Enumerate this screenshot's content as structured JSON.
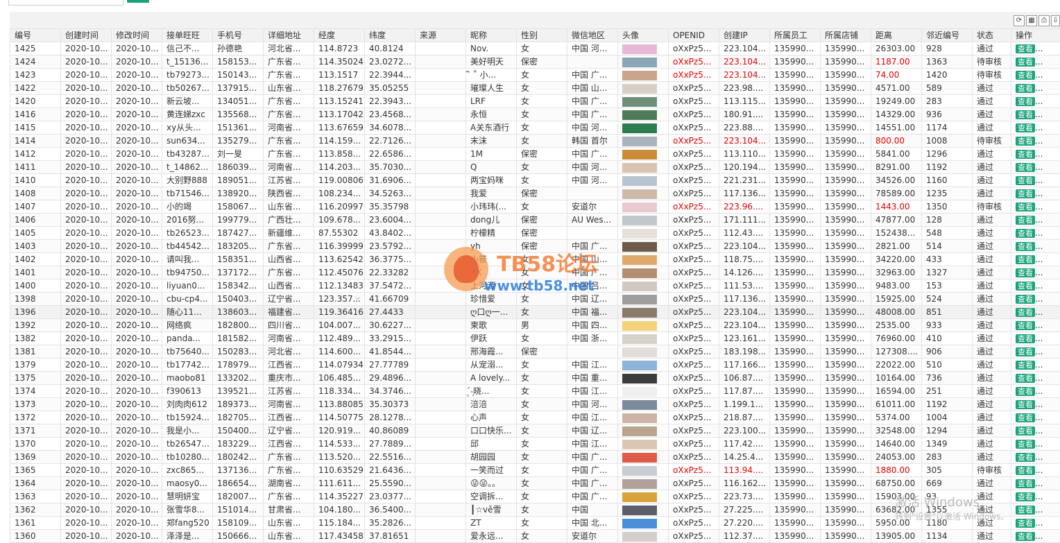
{
  "toolbar": {
    "search_placeholder": "",
    "search_button": "",
    "icons": [
      "refresh-icon",
      "columns-icon",
      "print-icon",
      "export-icon"
    ]
  },
  "columns": [
    "编号",
    "创建时间",
    "修改时间",
    "接单旺旺",
    "手机号",
    "详细地址",
    "经度",
    "纬度",
    "来源",
    "昵称",
    "性别",
    "微信地区",
    "头像",
    "OPENID",
    "创建IP",
    "所属员工",
    "所属店铺",
    "距离",
    "邻近编号",
    "状态",
    "操作"
  ],
  "view_label": "查看",
  "view_suffix": "...",
  "colors": {
    "accent": "#1aa37a",
    "alert": "#e60000"
  },
  "watermark": {
    "title": "TB58论坛",
    "url": "www.tb58.net"
  },
  "windows_watermark": {
    "line1": "激活 Windows",
    "line2": "转到\"设置\"以激活 Windows。"
  },
  "rows": [
    {
      "id": "1425",
      "c": "2020-10...",
      "m": "2020-10...",
      "ww": "信己不...",
      "ph": "孙德艳",
      "addr": "河北省...",
      "lng": "114.8723",
      "lat": "40.8124",
      "src": "",
      "nick": "Nov.",
      "sex": "女",
      "reg": "中国 河...",
      "av": "#e9b8d6",
      "oid": "oXxPz5...",
      "ip": "223.104...",
      "emp": "135990...",
      "shop": "135990...",
      "dist": "26303.00",
      "near": "928",
      "st": "通过",
      "red": false
    },
    {
      "id": "1424",
      "c": "2020-10...",
      "m": "2020-10...",
      "ww": "t_15136...",
      "ph": "158153...",
      "addr": "广东省...",
      "lng": "114.35024",
      "lat": "23.0272...",
      "src": "",
      "nick": "美好明天",
      "sex": "保密",
      "reg": "",
      "av": "#8aa7b8",
      "oid": "oXxPz5...",
      "ip": "223.104...",
      "emp": "135990...",
      "shop": "135990...",
      "dist": "1187.00",
      "near": "1363",
      "st": "待审核",
      "red": true
    },
    {
      "id": "1423",
      "c": "2020-10...",
      "m": "2020-10...",
      "ww": "tb79273...",
      "ph": "150143...",
      "addr": "广东省...",
      "lng": "113.1517",
      "lat": "22.3944...",
      "src": "",
      "nick": "ิ ˚ 小...",
      "sex": "女",
      "reg": "中国 广...",
      "av": "#c9a58e",
      "oid": "oXxPz5...",
      "ip": "223.104...",
      "emp": "135990...",
      "shop": "135990...",
      "dist": "74.00",
      "near": "1420",
      "st": "待审核",
      "red": true
    },
    {
      "id": "1422",
      "c": "2020-10...",
      "m": "2020-10...",
      "ww": "tb50267...",
      "ph": "137915...",
      "addr": "山东省...",
      "lng": "118.27679",
      "lat": "35.05255",
      "src": "",
      "nick": "璀璨人生",
      "sex": "女",
      "reg": "中国 山...",
      "av": "#d8cfc6",
      "oid": "oXxPz5...",
      "ip": "223.98....",
      "emp": "135990...",
      "shop": "135990...",
      "dist": "4571.00",
      "near": "589",
      "st": "通过",
      "red": false
    },
    {
      "id": "1420",
      "c": "2020-10...",
      "m": "2020-10...",
      "ww": "新云坡...",
      "ph": "134051...",
      "addr": "广东省...",
      "lng": "113.15241",
      "lat": "22.3943...",
      "src": "",
      "nick": "LRF",
      "sex": "女",
      "reg": "中国 广...",
      "av": "#6f8f7a",
      "oid": "oXxPz5...",
      "ip": "113.115...",
      "emp": "135990...",
      "shop": "135990...",
      "dist": "19249.00",
      "near": "283",
      "st": "通过",
      "red": false
    },
    {
      "id": "1416",
      "c": "2020-10...",
      "m": "2020-10...",
      "ww": "黄连娣zxc",
      "ph": "135568...",
      "addr": "广东省...",
      "lng": "113.17042",
      "lat": "23.4568...",
      "src": "",
      "nick": "永恒",
      "sex": "女",
      "reg": "中国 广...",
      "av": "#4f7d5c",
      "oid": "oXxPz5...",
      "ip": "180.91....",
      "emp": "135990...",
      "shop": "135990...",
      "dist": "14329.00",
      "near": "936",
      "st": "通过",
      "red": false
    },
    {
      "id": "1415",
      "c": "2020-10...",
      "m": "2020-10...",
      "ww": "xy从头...",
      "ph": "151361...",
      "addr": "河南省...",
      "lng": "113.67659",
      "lat": "34.6078...",
      "src": "",
      "nick": "A关东酒行",
      "sex": "女",
      "reg": "中国 河...",
      "av": "#2e7d4e",
      "oid": "oXxPz5...",
      "ip": "223.88....",
      "emp": "135990...",
      "shop": "135990...",
      "dist": "14551.00",
      "near": "1174",
      "st": "通过",
      "red": false
    },
    {
      "id": "1414",
      "c": "2020-10...",
      "m": "2020-10...",
      "ww": "sun634...",
      "ph": "135279...",
      "addr": "广东省...",
      "lng": "114.159...",
      "lat": "22.7126...",
      "src": "",
      "nick": "末沫",
      "sex": "女",
      "reg": "韩国 首尔",
      "av": "#a9b3bd",
      "oid": "oXxPz5...",
      "ip": "223.104...",
      "emp": "135990...",
      "shop": "135990...",
      "dist": "800.00",
      "near": "1008",
      "st": "待审核",
      "red": true
    },
    {
      "id": "1412",
      "c": "2020-10...",
      "m": "2020-10...",
      "ww": "tb43287...",
      "ph": "刘一旻",
      "addr": "广东省...",
      "lng": "113.858...",
      "lat": "22.6586...",
      "src": "",
      "nick": "1M",
      "sex": "保密",
      "reg": "中国 广...",
      "av": "#c98b3a",
      "oid": "oXxPz5...",
      "ip": "113.110...",
      "emp": "135990...",
      "shop": "135990...",
      "dist": "5841.00",
      "near": "1296",
      "st": "通过",
      "red": false
    },
    {
      "id": "1411",
      "c": "2020-10...",
      "m": "2020-10...",
      "ww": "t_14862...",
      "ph": "186039...",
      "addr": "河南省...",
      "lng": "114.203...",
      "lat": "35.7030...",
      "src": "",
      "nick": "Q",
      "sex": "女",
      "reg": "中国 河...",
      "av": "#d9c2b0",
      "oid": "oXxPz5...",
      "ip": "120.194...",
      "emp": "135990...",
      "shop": "135990...",
      "dist": "8291.00",
      "near": "1192",
      "st": "通过",
      "red": false
    },
    {
      "id": "1410",
      "c": "2020-10...",
      "m": "2020-10...",
      "ww": "大别野888",
      "ph": "189051...",
      "addr": "江苏省...",
      "lng": "119.00806",
      "lat": "31.6906...",
      "src": "",
      "nick": "两宝妈咪",
      "sex": "女",
      "reg": "中国 河...",
      "av": "#b7c4cf",
      "oid": "oXxPz5...",
      "ip": "221.231...",
      "emp": "135990...",
      "shop": "135990...",
      "dist": "34526.00",
      "near": "1160",
      "st": "通过",
      "red": false
    },
    {
      "id": "1408",
      "c": "2020-10...",
      "m": "2020-10...",
      "ww": "tb71546...",
      "ph": "138920...",
      "addr": "陕西省...",
      "lng": "108.234...",
      "lat": "34.5263...",
      "src": "",
      "nick": "我爱",
      "sex": "保密",
      "reg": "",
      "av": "#cdb9a8",
      "oid": "oXxPz5...",
      "ip": "117.136...",
      "emp": "135990...",
      "shop": "135990...",
      "dist": "78589.00",
      "near": "1235",
      "st": "通过",
      "red": false
    },
    {
      "id": "1407",
      "c": "2020-10...",
      "m": "2020-10...",
      "ww": "小的竭",
      "ph": "158067...",
      "addr": "山东省...",
      "lng": "116.20997",
      "lat": "35.35798",
      "src": "",
      "nick": "小玮玮(...",
      "sex": "女",
      "reg": "安道尔",
      "av": "#e8c9cf",
      "oid": "oXxPz5...",
      "ip": "223.96....",
      "emp": "135990...",
      "shop": "135990...",
      "dist": "1443.00",
      "near": "1350",
      "st": "待审核",
      "red": true
    },
    {
      "id": "1406",
      "c": "2020-10...",
      "m": "2020-10...",
      "ww": "2016努...",
      "ph": "199779...",
      "addr": "广西壮...",
      "lng": "109.678...",
      "lat": "23.6004...",
      "src": "",
      "nick": "dong儿",
      "sex": "保密",
      "reg": "AU Wes...",
      "av": "#c2c7cc",
      "oid": "oXxPz5...",
      "ip": "171.111...",
      "emp": "135990...",
      "shop": "135990...",
      "dist": "47877.00",
      "near": "128",
      "st": "通过",
      "red": false
    },
    {
      "id": "1405",
      "c": "2020-10...",
      "m": "2020-10...",
      "ww": "tb26523...",
      "ph": "187427...",
      "addr": "新疆维...",
      "lng": "87.55302",
      "lat": "43.8402...",
      "src": "",
      "nick": "柠檬精",
      "sex": "保密",
      "reg": "",
      "av": "#e6e0da",
      "oid": "oXxPz5...",
      "ip": "112.43....",
      "emp": "135990...",
      "shop": "135990...",
      "dist": "152438...",
      "near": "548",
      "st": "通过",
      "red": false
    },
    {
      "id": "1403",
      "c": "2020-10...",
      "m": "2020-10...",
      "ww": "tb44542...",
      "ph": "183205...",
      "addr": "广东省...",
      "lng": "116.39999",
      "lat": "23.5792...",
      "src": "",
      "nick": "yh",
      "sex": "保密",
      "reg": "中国 广...",
      "av": "#6e5a4a",
      "oid": "oXxPz5...",
      "ip": "223.104...",
      "emp": "135990...",
      "shop": "135990...",
      "dist": "2821.00",
      "near": "514",
      "st": "通过",
      "red": false
    },
    {
      "id": "1402",
      "c": "2020-10...",
      "m": "2020-10...",
      "ww": "请叫我...",
      "ph": "158351...",
      "addr": "山西省...",
      "lng": "113.62542",
      "lat": "36.3775...",
      "src": "",
      "nick": "小筱",
      "sex": "女",
      "reg": "中国 山...",
      "av": "#e0a96a",
      "oid": "oXxPz5...",
      "ip": "118.75....",
      "emp": "135990...",
      "shop": "135990...",
      "dist": "34220.00",
      "near": "433",
      "st": "通过",
      "red": false
    },
    {
      "id": "1401",
      "c": "2020-10...",
      "m": "2020-10...",
      "ww": "tb94750...",
      "ph": "137172...",
      "addr": "广东省...",
      "lng": "112.45076",
      "lat": "22.33282",
      "src": "",
      "nick": "XX",
      "sex": "女",
      "reg": "中国 广...",
      "av": "#b38f6f",
      "oid": "oXxPz5...",
      "ip": "14.126....",
      "emp": "135990...",
      "shop": "135990...",
      "dist": "32963.00",
      "near": "1327",
      "st": "通过",
      "red": false
    },
    {
      "id": "1400",
      "c": "2020-10...",
      "m": "2020-10...",
      "ww": "liyuan0...",
      "ph": "158342...",
      "addr": "山西省...",
      "lng": "112.13483",
      "lat": "37.5472...",
      "src": "",
      "nick": "上河源",
      "sex": "女",
      "reg": "中国 吕...",
      "av": "#d2c8c0",
      "oid": "oXxPz5...",
      "ip": "111.53....",
      "emp": "135990...",
      "shop": "135990...",
      "dist": "9483.00",
      "near": "153",
      "st": "通过",
      "red": false
    },
    {
      "id": "1398",
      "c": "2020-10...",
      "m": "2020-10...",
      "ww": "cbu-cp4...",
      "ph": "150403...",
      "addr": "辽宁省...",
      "lng": "123.357...",
      "lat": "41.66709",
      "src": "",
      "nick": "珍惜爱",
      "sex": "女",
      "reg": "中国 辽...",
      "av": "#9e9e9e",
      "oid": "oXxPz5...",
      "ip": "117.136...",
      "emp": "135990...",
      "shop": "135990...",
      "dist": "15925.00",
      "near": "524",
      "st": "通过",
      "red": false
    },
    {
      "id": "1396",
      "c": "2020-10...",
      "m": "2020-10...",
      "ww": "随心11...",
      "ph": "138603...",
      "addr": "福建省...",
      "lng": "119.36416",
      "lat": "27.4433",
      "src": "",
      "nick": "ღ口ღ一...",
      "sex": "女",
      "reg": "中国 福...",
      "av": "#8a7a6c",
      "oid": "oXxPz5...",
      "ip": "223.104...",
      "emp": "135990...",
      "shop": "135990...",
      "dist": "48008.00",
      "near": "851",
      "st": "通过",
      "red": false,
      "hl": true
    },
    {
      "id": "1392",
      "c": "2020-10...",
      "m": "2020-10...",
      "ww": "网络疯",
      "ph": "182800...",
      "addr": "四川省...",
      "lng": "104.007...",
      "lat": "30.6227...",
      "src": "",
      "nick": "柬歌",
      "sex": "男",
      "reg": "中国 四...",
      "av": "#f3d27a",
      "oid": "oXxPz5...",
      "ip": "223.104...",
      "emp": "135990...",
      "shop": "135990...",
      "dist": "2535.00",
      "near": "933",
      "st": "通过",
      "red": false
    },
    {
      "id": "1382",
      "c": "2020-10...",
      "m": "2020-10...",
      "ww": "panda...",
      "ph": "181582...",
      "addr": "河南省...",
      "lng": "112.489...",
      "lat": "33.2915...",
      "src": "",
      "nick": "伊跃",
      "sex": "女",
      "reg": "中国 浙...",
      "av": "#d6d1cb",
      "oid": "oXxPz5...",
      "ip": "123.161...",
      "emp": "135990...",
      "shop": "135990...",
      "dist": "76960.00",
      "near": "410",
      "st": "通过",
      "red": false
    },
    {
      "id": "1381",
      "c": "2020-10...",
      "m": "2020-10...",
      "ww": "tb75640...",
      "ph": "150283...",
      "addr": "河北省...",
      "lng": "114.600...",
      "lat": "41.8544...",
      "src": "",
      "nick": "邢海霞...",
      "sex": "保密",
      "reg": "",
      "av": "#e2ddd7",
      "oid": "oXxPz5...",
      "ip": "183.198...",
      "emp": "135990...",
      "shop": "135990...",
      "dist": "127308....",
      "near": "906",
      "st": "通过",
      "red": false
    },
    {
      "id": "1379",
      "c": "2020-10...",
      "m": "2020-10...",
      "ww": "tb17742...",
      "ph": "178979...",
      "addr": "江西省...",
      "lng": "114.07934",
      "lat": "27.77789",
      "src": "",
      "nick": "从宠溺...",
      "sex": "女",
      "reg": "中国 江...",
      "av": "#8db3d9",
      "oid": "oXxPz5...",
      "ip": "117.166...",
      "emp": "135990...",
      "shop": "135990...",
      "dist": "22022.00",
      "near": "510",
      "st": "通过",
      "red": false
    },
    {
      "id": "1375",
      "c": "2020-10...",
      "m": "2020-10...",
      "ww": "maobo81",
      "ph": "133202...",
      "addr": "重庆市...",
      "lng": "106.485...",
      "lat": "29.4896...",
      "src": "",
      "nick": "A lovely...",
      "sex": "女",
      "reg": "中国 重...",
      "av": "#3d3d3d",
      "oid": "oXxPz5...",
      "ip": "106.87....",
      "emp": "135990...",
      "shop": "135990...",
      "dist": "10164.00",
      "near": "736",
      "st": "通过",
      "red": false
    },
    {
      "id": "1374",
      "c": "2020-10...",
      "m": "2020-10...",
      "ww": "f390613",
      "ph": "139521...",
      "addr": "江苏省...",
      "lng": "118.334...",
      "lat": "34.3746...",
      "src": "",
      "nick": "  ̖́-͙晓...",
      "sex": "女",
      "reg": "中国 江...",
      "av": "#efefef",
      "oid": "oXxPz5...",
      "ip": "117.87....",
      "emp": "135990...",
      "shop": "135990...",
      "dist": "16594.00",
      "near": "251",
      "st": "通过",
      "red": false
    },
    {
      "id": "1373",
      "c": "2020-10...",
      "m": "2020-10...",
      "ww": "刘肉肉612",
      "ph": "189373...",
      "addr": "河南省...",
      "lng": "113.88085",
      "lat": "35.30373",
      "src": "",
      "nick": "涪涪",
      "sex": "女",
      "reg": "中国 河...",
      "av": "#7d8a99",
      "oid": "oXxPz5...",
      "ip": "1.199.1...",
      "emp": "135990...",
      "shop": "135990...",
      "dist": "61011.00",
      "near": "1192",
      "st": "通过",
      "red": false
    },
    {
      "id": "1372",
      "c": "2020-10...",
      "m": "2020-10...",
      "ww": "tb15924...",
      "ph": "182705...",
      "addr": "江西省...",
      "lng": "114.50775",
      "lat": "28.1278...",
      "src": "",
      "nick": "心声",
      "sex": "女",
      "reg": "中国 江...",
      "av": "#cbb4a6",
      "oid": "oXxPz5...",
      "ip": "218.87....",
      "emp": "135990...",
      "shop": "135990...",
      "dist": "5374.00",
      "near": "1004",
      "st": "通过",
      "red": false
    },
    {
      "id": "1371",
      "c": "2020-10...",
      "m": "2020-10...",
      "ww": "我是小...",
      "ph": "150400...",
      "addr": "辽宁省...",
      "lng": "120.919...",
      "lat": "40.86089",
      "src": "",
      "nick": "口口快乐...",
      "sex": "女",
      "reg": "中国 辽...",
      "av": "#b9a48f",
      "oid": "oXxPz5...",
      "ip": "223.100...",
      "emp": "135990...",
      "shop": "135990...",
      "dist": "32548.00",
      "near": "1294",
      "st": "通过",
      "red": false
    },
    {
      "id": "1370",
      "c": "2020-10...",
      "m": "2020-10...",
      "ww": "tb26547...",
      "ph": "183229...",
      "addr": "江西省...",
      "lng": "114.533...",
      "lat": "27.7889...",
      "src": "",
      "nick": "邱",
      "sex": "女",
      "reg": "中国 江...",
      "av": "#d9c6b3",
      "oid": "oXxPz5...",
      "ip": "117.42....",
      "emp": "135990...",
      "shop": "135990...",
      "dist": "14640.00",
      "near": "1349",
      "st": "通过",
      "red": false
    },
    {
      "id": "1369",
      "c": "2020-10...",
      "m": "2020-10...",
      "ww": "tb10280...",
      "ph": "180242...",
      "addr": "广东省...",
      "lng": "113.520...",
      "lat": "22.5516...",
      "src": "",
      "nick": "胡园园",
      "sex": "女",
      "reg": "中国 广...",
      "av": "#e05a4a",
      "oid": "oXxPz5...",
      "ip": "14.25.4...",
      "emp": "135990...",
      "shop": "135990...",
      "dist": "24053.00",
      "near": "283",
      "st": "通过",
      "red": false
    },
    {
      "id": "1365",
      "c": "2020-10...",
      "m": "2020-10...",
      "ww": "zxc865...",
      "ph": "137136...",
      "addr": "广东省...",
      "lng": "110.63529",
      "lat": "21.6436...",
      "src": "",
      "nick": "一笑而过",
      "sex": "女",
      "reg": "中国 广...",
      "av": "#c9ccd1",
      "oid": "oXxPz5...",
      "ip": "113.94....",
      "emp": "135990...",
      "shop": "135990...",
      "dist": "1880.00",
      "near": "305",
      "st": "待审核",
      "red": true
    },
    {
      "id": "1364",
      "c": "2020-10...",
      "m": "2020-10...",
      "ww": "maosy0...",
      "ph": "186654...",
      "addr": "湖南省...",
      "lng": "111.611...",
      "lat": "25.5590...",
      "src": "",
      "nick": "😜😜。。",
      "sex": "女",
      "reg": "中国 广...",
      "av": "#b1a19a",
      "oid": "oXxPz5...",
      "ip": "116.162...",
      "emp": "135990...",
      "shop": "135990...",
      "dist": "68750.00",
      "near": "669",
      "st": "通过",
      "red": false
    },
    {
      "id": "1363",
      "c": "2020-10...",
      "m": "2020-10...",
      "ww": "慧明妍宝",
      "ph": "182007...",
      "addr": "广东省...",
      "lng": "114.35227",
      "lat": "23.0377...",
      "src": "",
      "nick": "空调拆...",
      "sex": "女",
      "reg": "中国 广...",
      "av": "#d7a33a",
      "oid": "oXxPz5...",
      "ip": "223.73....",
      "emp": "135990...",
      "shop": "135990...",
      "dist": "15903.00",
      "near": "93",
      "st": "通过",
      "red": false
    },
    {
      "id": "1362",
      "c": "2020-10...",
      "m": "2020-10...",
      "ww": "张雪华8...",
      "ph": "151014...",
      "addr": "甘肃省...",
      "lng": "104.180...",
      "lat": "36.5400...",
      "src": "",
      "nick": "┃☆vě雪",
      "sex": "女",
      "reg": "中国",
      "av": "#5a5f6b",
      "oid": "oXxPz5...",
      "ip": "27.225....",
      "emp": "135990...",
      "shop": "135990...",
      "dist": "63682.00",
      "near": "1355",
      "st": "通过",
      "red": false
    },
    {
      "id": "1361",
      "c": "2020-10...",
      "m": "2020-10...",
      "ww": "郑fang520",
      "ph": "158109...",
      "addr": "山东省...",
      "lng": "115.184...",
      "lat": "35.2826...",
      "src": "",
      "nick": "ZT",
      "sex": "女",
      "reg": "中国 北...",
      "av": "#4a90d9",
      "oid": "oXxPz5...",
      "ip": "27.220....",
      "emp": "135990...",
      "shop": "135990...",
      "dist": "5950.00",
      "near": "1180",
      "st": "通过",
      "red": false
    },
    {
      "id": "1360",
      "c": "2020-10...",
      "m": "2020-10...",
      "ww": "泽泽是...",
      "ph": "150666...",
      "addr": "山东省...",
      "lng": "117.43458",
      "lat": "37.81651",
      "src": "",
      "nick": "爱永远...",
      "sex": "女",
      "reg": "安道尔",
      "av": "#d4cfc9",
      "oid": "oXxPz5...",
      "ip": "112.37....",
      "emp": "135990...",
      "shop": "135990...",
      "dist": "13905.00",
      "near": "1134",
      "st": "通过",
      "red": false
    }
  ]
}
